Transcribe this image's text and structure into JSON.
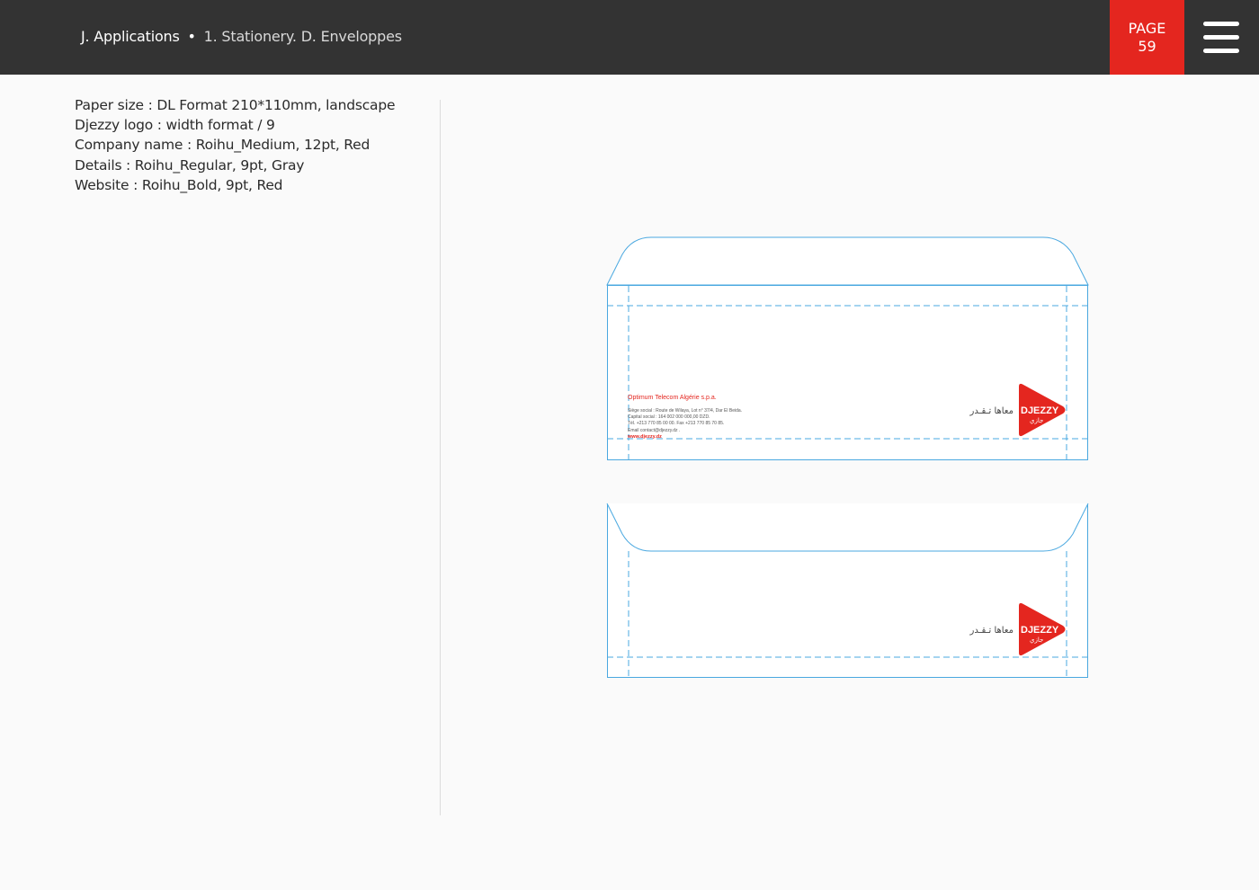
{
  "header": {
    "section": "J. Applications",
    "separator": "•",
    "subsection": "1. Stationery. D. Enveloppes",
    "page_label": "PAGE",
    "page_number": "59"
  },
  "specs": [
    "Paper size : DL Format 210*110mm, landscape",
    "Djezzy logo : width format / 9",
    "Company name : Roihu_Medium, 12pt, Red",
    "Details : Roihu_Regular, 9pt, Gray",
    "Website : Roihu_Bold, 9pt, Red"
  ],
  "envelope_front": {
    "company_name": "Optimum Telecom Algérie s.p.a.",
    "details": [
      "Siège social : Route de Wilaya, Lot n° 37/4, Dar El Beida.",
      "Capital social : 164 002 000 000,00 DZD.",
      "Tél. +213 770 85 00 00. Fax +213 770 85 70 85.",
      "Email contact@djezzy.dz ."
    ],
    "website": "www.djezzy.dz"
  },
  "logo": {
    "brand": "DJEZZY",
    "brand_arabic": "جازي",
    "tagline_arabic": "معاها تـقـدر"
  },
  "colors": {
    "header_bg": "#333333",
    "accent_red": "#e4261f",
    "guide_blue": "#4aa8e0",
    "text_dark": "#2b2b2b",
    "detail_gray": "#555555"
  }
}
